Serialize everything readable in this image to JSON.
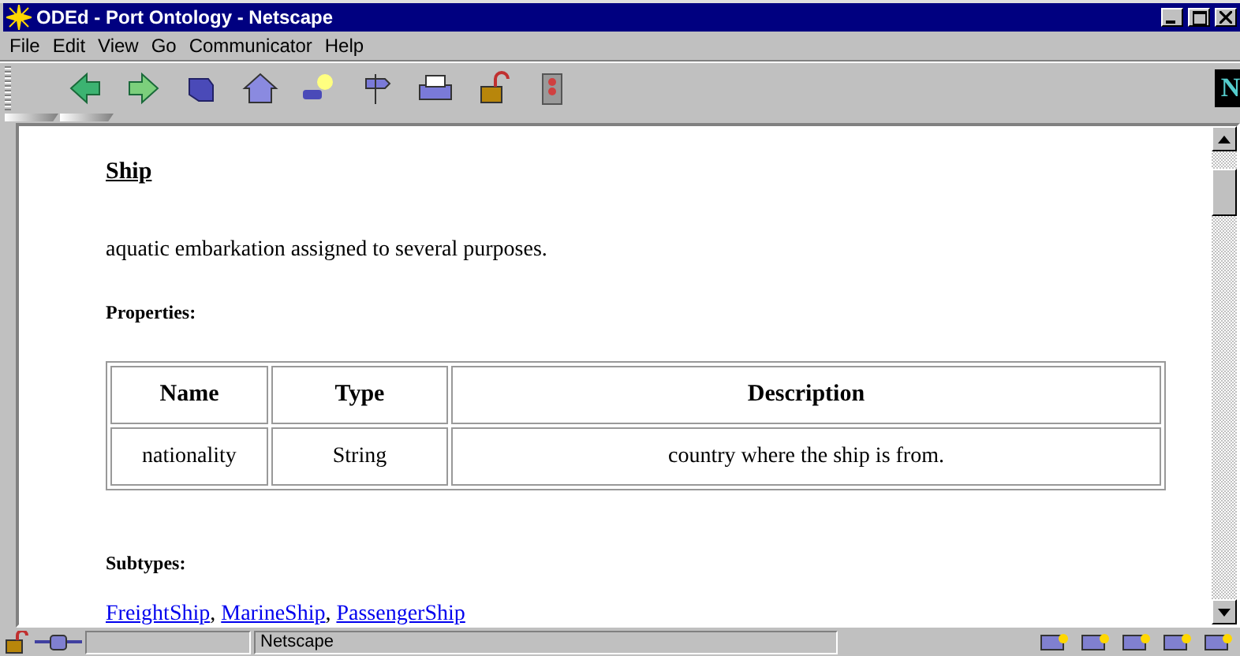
{
  "window": {
    "title": "ODEd - Port Ontology - Netscape"
  },
  "menu": [
    "File",
    "Edit",
    "View",
    "Go",
    "Communicator",
    "Help"
  ],
  "toolbar": {
    "logo": "N"
  },
  "page": {
    "heading": "Ship",
    "description": "aquatic embarkation assigned to several purposes.",
    "properties_label": "Properties:",
    "table": {
      "columns": [
        "Name",
        "Type",
        "Description"
      ],
      "rows": [
        [
          "nationality",
          "String",
          "country where the ship is from."
        ]
      ]
    },
    "subtypes_label": "Subtypes:",
    "subtypes": [
      "FreightShip",
      "MarineShip",
      "PassengerShip"
    ],
    "separator": ","
  },
  "status_bar": {
    "message": "Netscape"
  }
}
